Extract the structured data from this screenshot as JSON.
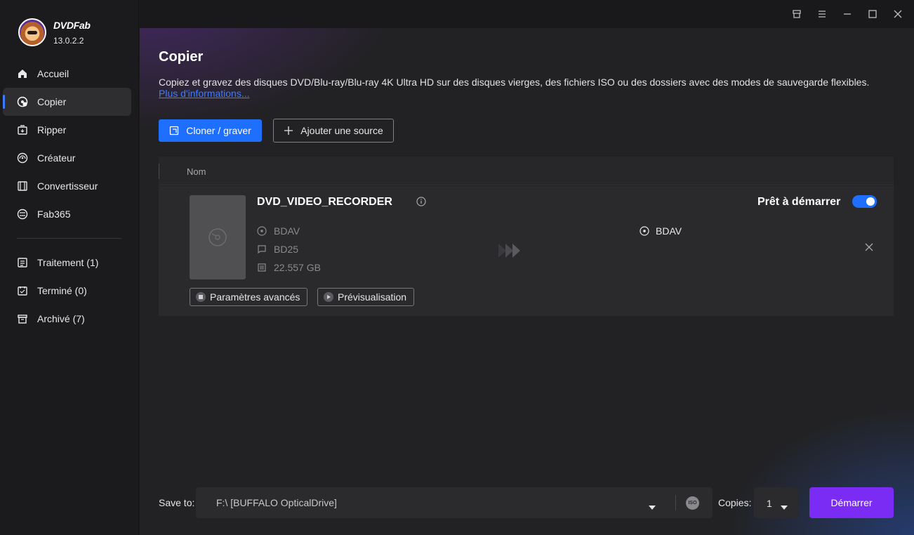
{
  "app": {
    "name": "DVDFab",
    "version": "13.0.2.2"
  },
  "sidebar": {
    "items": [
      {
        "label": "Accueil",
        "icon": "home-icon"
      },
      {
        "label": "Copier",
        "icon": "disc-copy-icon",
        "active": true
      },
      {
        "label": "Ripper",
        "icon": "ripper-icon"
      },
      {
        "label": "Créateur",
        "icon": "creator-icon"
      },
      {
        "label": "Convertisseur",
        "icon": "converter-icon"
      },
      {
        "label": "Fab365",
        "icon": "fab365-icon"
      }
    ],
    "queue": [
      {
        "label": "Traitement (1)",
        "icon": "processing-icon"
      },
      {
        "label": "Terminé (0)",
        "icon": "done-icon"
      },
      {
        "label": "Archivé (7)",
        "icon": "archive-icon"
      }
    ]
  },
  "titlebar": {
    "icons": [
      "skin-icon",
      "menu-icon",
      "minimize-icon",
      "maximize-icon",
      "close-icon"
    ]
  },
  "main": {
    "title": "Copier",
    "description": "Copiez et gravez des disques DVD/Blu-ray/Blu-ray 4K Ultra HD sur des disques vierges, des fichiers ISO ou des dossiers avec des modes de sauvegarde flexibles.",
    "more_link": "Plus d'informations...",
    "clone_button": "Cloner / graver",
    "add_source_button": "Ajouter une source",
    "table": {
      "column_name": "Nom",
      "item": {
        "title": "DVD_VIDEO_RECORDER",
        "source_format": "BDAV",
        "disc_type": "BD25",
        "size": "22.557 GB",
        "target_format": "BDAV",
        "status": "Prêt à démarrer",
        "enabled": true,
        "advanced_button": "Paramètres avancés",
        "preview_button": "Prévisualisation"
      }
    }
  },
  "footer": {
    "save_to_label": "Save to:",
    "save_to_value": "F:\\ [BUFFALO OpticalDrive]",
    "iso_label": "ISO",
    "copies_label": "Copies:",
    "copies_value": "1",
    "start_button": "Démarrer"
  },
  "colors": {
    "accent": "#1f6fff",
    "start": "#7a2cf5",
    "link": "#3d7bff"
  }
}
